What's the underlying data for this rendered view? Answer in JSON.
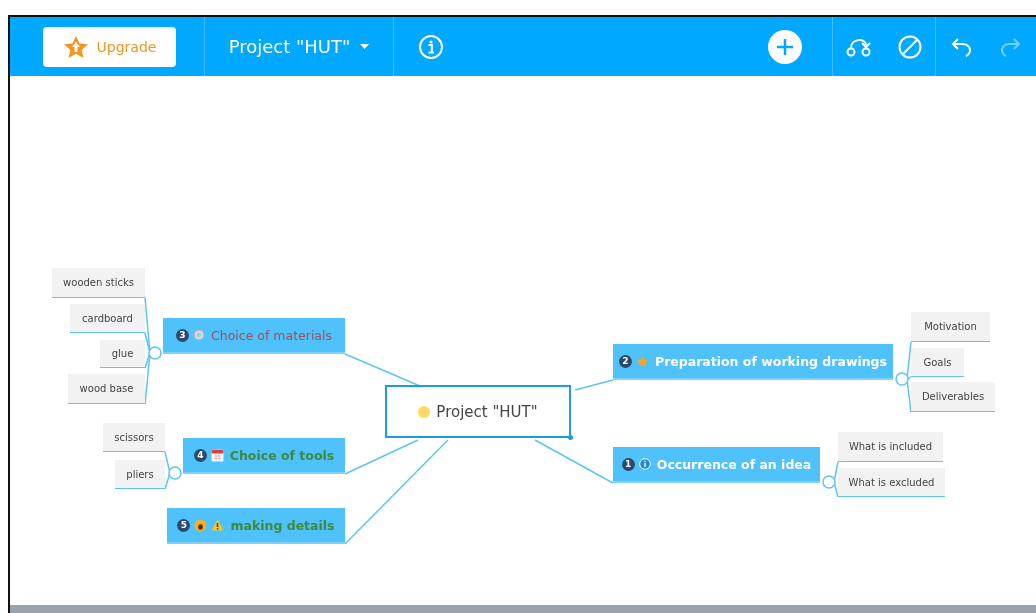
{
  "toolbar": {
    "upgrade_button": "Upgrade",
    "project_title": "Project \"HUT\"",
    "redo_disabled": true
  },
  "central_topic": {
    "label": "Project \"HUT\"",
    "selected": true
  },
  "topics": [
    {
      "number": "3",
      "markers": [
        {
          "kind": "gear"
        }
      ],
      "label": "Choice of materials",
      "color": "#a0505a",
      "bold": false,
      "children": [
        {
          "label": "wooden sticks"
        },
        {
          "label": "cardboard"
        },
        {
          "label": "glue"
        },
        {
          "label": "wood base"
        }
      ]
    },
    {
      "number": "4",
      "markers": [
        {
          "kind": "calendar"
        }
      ],
      "label": "Choice of tools",
      "color": "#3d8a3d",
      "bold": true,
      "children": [
        {
          "label": "scissors"
        },
        {
          "label": "pliers"
        }
      ]
    },
    {
      "number": "5",
      "markers": [
        {
          "kind": "emoji"
        },
        {
          "kind": "warning"
        }
      ],
      "label": "making details",
      "color": "#3d8a3d",
      "bold": true
    },
    {
      "number": "2",
      "markers": [
        {
          "kind": "star"
        }
      ],
      "label": "Preparation of working drawings",
      "color": "#ffffff",
      "bold": true,
      "children": [
        {
          "label": "Motivation"
        },
        {
          "label": "Goals"
        },
        {
          "label": "Deliverables"
        }
      ]
    },
    {
      "number": "1",
      "markers": [
        {
          "kind": "info"
        }
      ],
      "label": "Occurrence of an idea",
      "color": "#ffffff",
      "bold": true,
      "children": [
        {
          "label": "What is included"
        },
        {
          "label": "What is excluded"
        }
      ]
    }
  ]
}
